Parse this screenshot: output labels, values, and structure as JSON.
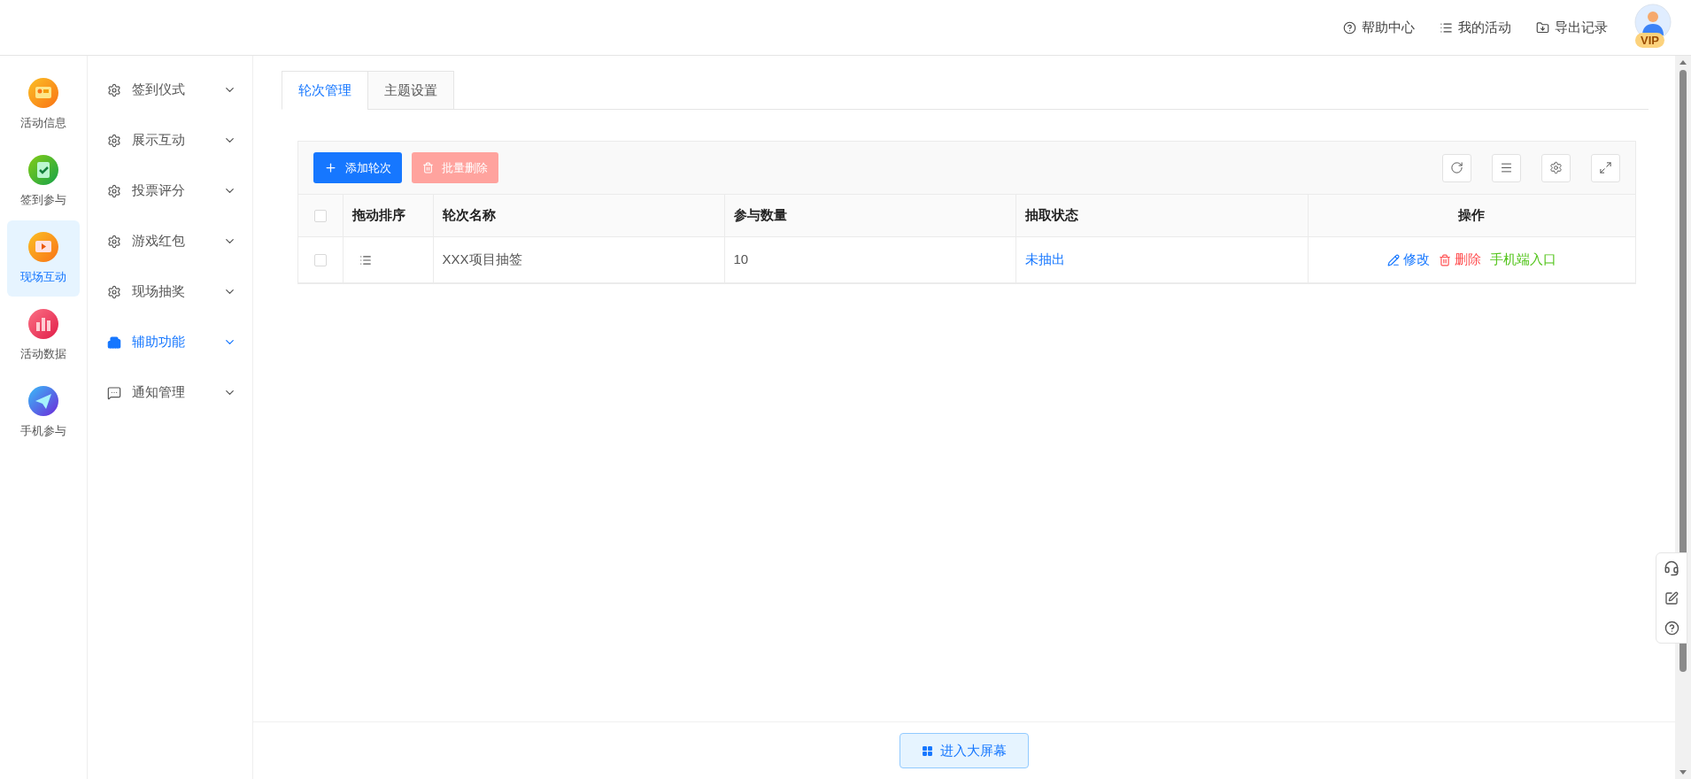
{
  "header": {
    "links": [
      {
        "label": "帮助中心",
        "kind": "help"
      },
      {
        "label": "我的活动",
        "kind": "list"
      },
      {
        "label": "导出记录",
        "kind": "export"
      }
    ],
    "avatar_badge": "VIP"
  },
  "rail": [
    {
      "label": "活动信息",
      "selected": false
    },
    {
      "label": "签到参与",
      "selected": false
    },
    {
      "label": "现场互动",
      "selected": true
    },
    {
      "label": "活动数据",
      "selected": false
    },
    {
      "label": "手机参与",
      "selected": false
    }
  ],
  "menu": [
    {
      "label": "签到仪式",
      "selected": false,
      "expanded": false
    },
    {
      "label": "展示互动",
      "selected": false,
      "expanded": false
    },
    {
      "label": "投票评分",
      "selected": false,
      "expanded": false
    },
    {
      "label": "游戏红包",
      "selected": false,
      "expanded": false
    },
    {
      "label": "现场抽奖",
      "selected": false,
      "expanded": false
    },
    {
      "label": "辅助功能",
      "selected": true,
      "expanded": false
    },
    {
      "label": "通知管理",
      "selected": false,
      "expanded": false
    }
  ],
  "tabs": [
    {
      "label": "轮次管理",
      "selected": true
    },
    {
      "label": "主题设置",
      "selected": false
    }
  ],
  "toolbar": {
    "buttons": [
      {
        "label": "添加轮次",
        "kind": "add",
        "disabled": false
      },
      {
        "label": "批量删除",
        "kind": "delete",
        "disabled": true
      }
    ]
  },
  "table": {
    "select_all": {
      "checked": false
    },
    "columns": [
      "拖动排序",
      "轮次名称",
      "参与数量",
      "抽取状态",
      "操作"
    ],
    "rows": [
      {
        "checked": false,
        "name": "XXX项目抽签",
        "count": "10",
        "status": "未抽出",
        "actions": [
          {
            "label": "修改",
            "kind": "edit"
          },
          {
            "label": "删除",
            "kind": "delete"
          },
          {
            "label": "手机端入口",
            "kind": "mobile"
          }
        ]
      }
    ]
  },
  "footer": {
    "button": "进入大屏幕"
  }
}
